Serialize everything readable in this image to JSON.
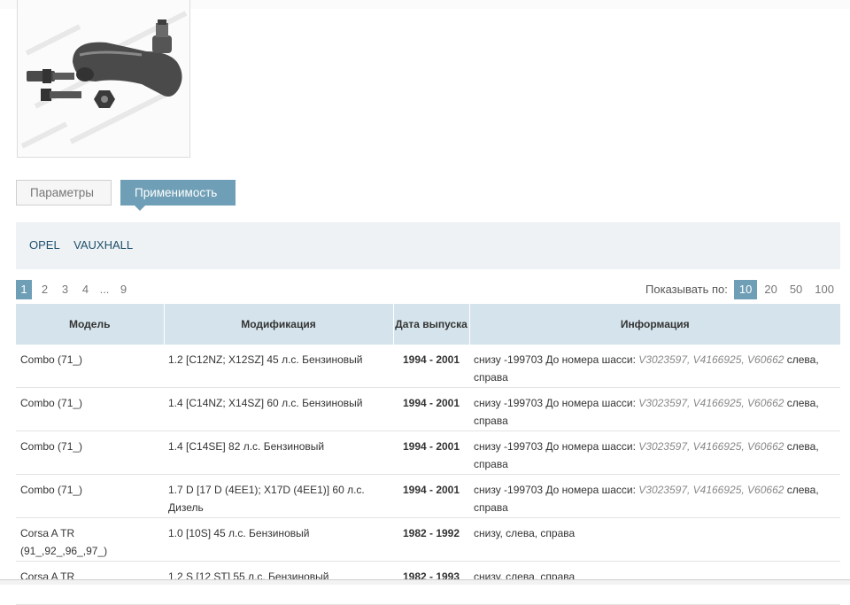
{
  "tabs": {
    "params": "Параметры",
    "applicability": "Применимость"
  },
  "brands": [
    "OPEL",
    "VAUXHALL"
  ],
  "pagination": {
    "pages": [
      "1",
      "2",
      "3",
      "4"
    ],
    "current": "1",
    "ellipsis": "...",
    "last": "9"
  },
  "per_page": {
    "label": "Показывать по:",
    "options": [
      "10",
      "20",
      "50",
      "100"
    ],
    "selected": "10"
  },
  "table": {
    "headers": {
      "model": "Модель",
      "modification": "Модификация",
      "date": "Дата выпуска",
      "info": "Информация"
    },
    "rows": [
      {
        "model": "Combo (71_)",
        "modification": "1.2 [C12NZ; X12SZ] 45 л.с. Бензиновый",
        "years": "1994 - 2001",
        "info_prefix": "снизу -199703 До номера шасси: ",
        "chassis": "V3023597, V4166925, V60662",
        "info_suffix": " слева, справа"
      },
      {
        "model": "Combo (71_)",
        "modification": "1.4 [C14NZ; X14SZ] 60 л.с. Бензиновый",
        "years": "1994 - 2001",
        "info_prefix": "снизу -199703 До номера шасси: ",
        "chassis": "V3023597, V4166925, V60662",
        "info_suffix": " слева, справа"
      },
      {
        "model": "Combo (71_)",
        "modification": "1.4 [C14SE] 82 л.с. Бензиновый",
        "years": "1994 - 2001",
        "info_prefix": "снизу -199703 До номера шасси: ",
        "chassis": "V3023597, V4166925, V60662",
        "info_suffix": " слева, справа"
      },
      {
        "model": "Combo (71_)",
        "modification": "1.7 D [17 D (4EE1); X17D (4EE1)] 60 л.с. Дизель",
        "years": "1994 - 2001",
        "info_prefix": "снизу -199703 До номера шасси: ",
        "chassis": "V3023597, V4166925, V60662",
        "info_suffix": " слева, справа"
      },
      {
        "model": "Corsa A TR (91_,92_,96_,97_)",
        "modification": "1.0 [10S] 45 л.с. Бензиновый",
        "years": "1982 - 1992",
        "info_prefix": "снизу, слева, справа",
        "chassis": "",
        "info_suffix": ""
      },
      {
        "model": "Corsa A TR",
        "modification": "1.2 S [12 ST] 55 л.с. Бензиновый",
        "years": "1982 - 1993",
        "info_prefix": "снизу, слева, справа",
        "chassis": "",
        "info_suffix": ""
      }
    ]
  },
  "image": {
    "watermark": "DELPHI PROPRIETARY"
  }
}
